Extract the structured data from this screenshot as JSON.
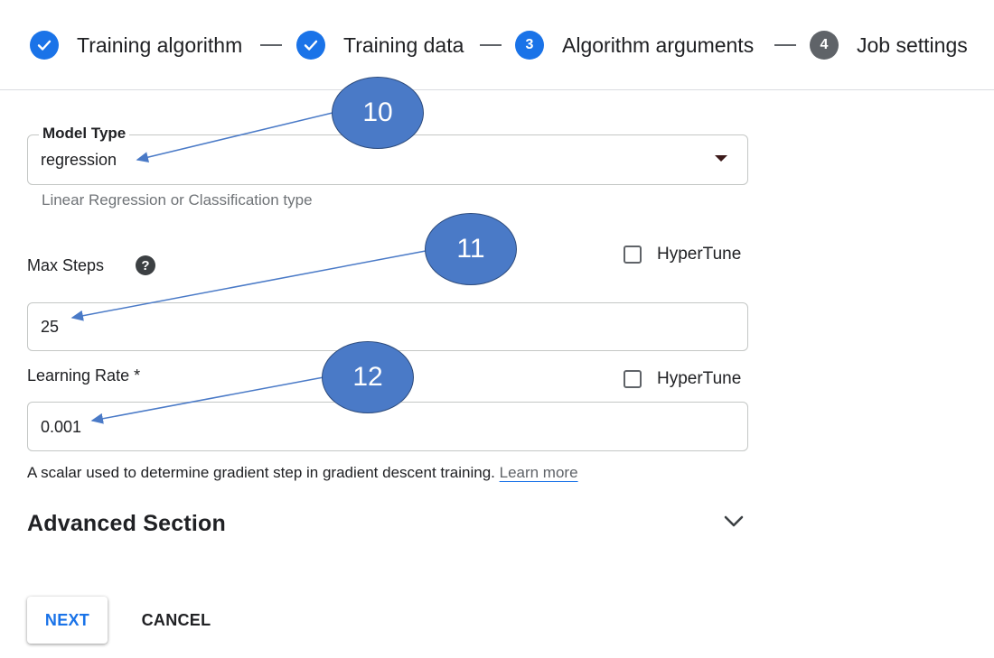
{
  "stepper": {
    "steps": [
      {
        "label": "Training algorithm",
        "status": "done",
        "marker": "✓"
      },
      {
        "label": "Training data",
        "status": "done",
        "marker": "✓"
      },
      {
        "label": "Algorithm arguments",
        "status": "current",
        "marker": "3"
      },
      {
        "label": "Job settings",
        "status": "pending",
        "marker": "4"
      }
    ]
  },
  "form": {
    "model_type": {
      "label": "Model Type",
      "value": "regression",
      "hint": "Linear Regression or Classification type"
    },
    "max_steps": {
      "label": "Max Steps",
      "value": "25",
      "hypertune_label": "HyperTune",
      "hypertune_checked": false
    },
    "learning_rate": {
      "label": "Learning Rate *",
      "value": "0.001",
      "hypertune_label": "HyperTune",
      "hypertune_checked": false,
      "hint": "A scalar used to determine gradient step in gradient descent training.",
      "learn_more": "Learn more"
    },
    "advanced_section": {
      "title": "Advanced Section"
    }
  },
  "buttons": {
    "next": "NEXT",
    "cancel": "CANCEL"
  },
  "annotations": [
    "10",
    "11",
    "12"
  ],
  "colors": {
    "accent": "#1a73e8",
    "annotation_fill": "#4a7ac7",
    "pending_step": "#5f6368"
  }
}
